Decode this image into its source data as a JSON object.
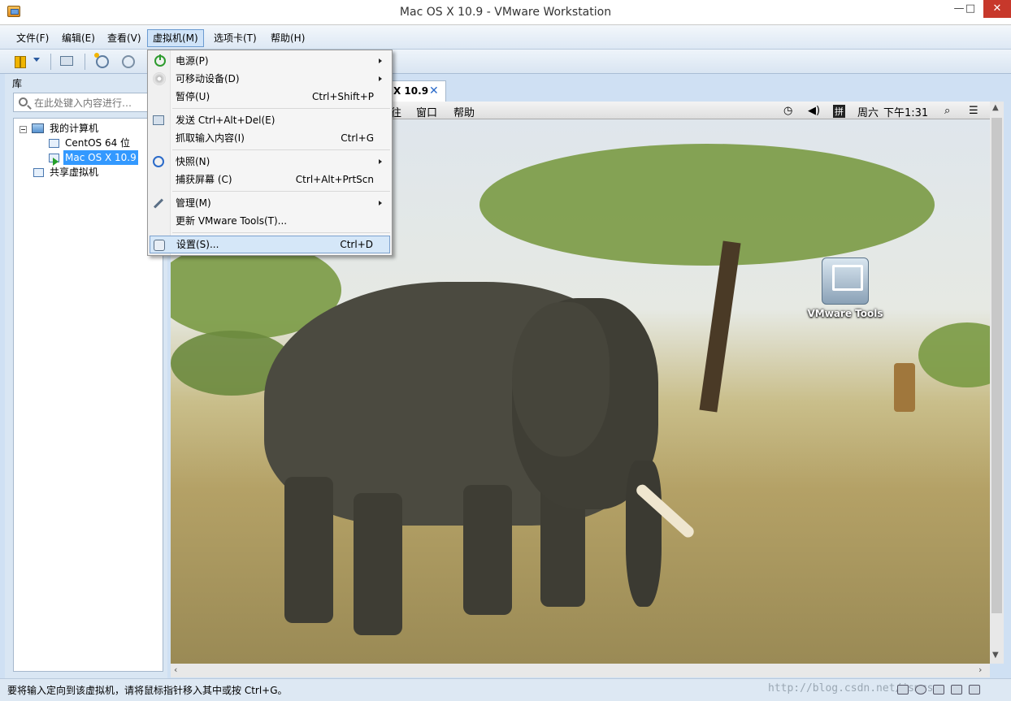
{
  "window": {
    "title": "Mac OS X 10.9 - VMware Workstation",
    "minimize": "—",
    "maximize": "□",
    "close": "✕"
  },
  "menubar": {
    "file": "文件(F)",
    "edit": "编辑(E)",
    "view": "查看(V)",
    "vm": "虚拟机(M)",
    "tabs": "选项卡(T)",
    "help": "帮助(H)"
  },
  "library": {
    "header": "库",
    "search_placeholder": "在此处键入内容进行…",
    "tree": {
      "my_computer": "我的计算机",
      "centos": "CentOS 64 位",
      "macos": "Mac OS X 10.9",
      "shared": "共享虚拟机"
    }
  },
  "vm_menu": {
    "power": "电源(P)",
    "removable": "可移动设备(D)",
    "pause": "暂停(U)",
    "pause_sc": "Ctrl+Shift+P",
    "send_cad": "发送 Ctrl+Alt+Del(E)",
    "grab_input": "抓取输入内容(I)",
    "grab_sc": "Ctrl+G",
    "snapshot": "快照(N)",
    "capture": "捕获屏幕 (C)",
    "capture_sc": "Ctrl+Alt+PrtScn",
    "manage": "管理(M)",
    "update_tools": "更新 VMware Tools(T)...",
    "settings": "设置(S)...",
    "settings_sc": "Ctrl+D"
  },
  "vm_tab": {
    "label": "X 10.9",
    "close": "✕"
  },
  "guest_menubar": {
    "go": "往",
    "window": "窗口",
    "help": "帮助",
    "day": "周六",
    "time": "下午1:31"
  },
  "desktop": {
    "vmware_tools_label": "VMware Tools"
  },
  "statusbar": {
    "message": "要将输入定向到该虚拟机，请将鼠标指针移入其中或按 Ctrl+G。",
    "watermark": "http://blog.csdn.net/jsmcsn"
  }
}
